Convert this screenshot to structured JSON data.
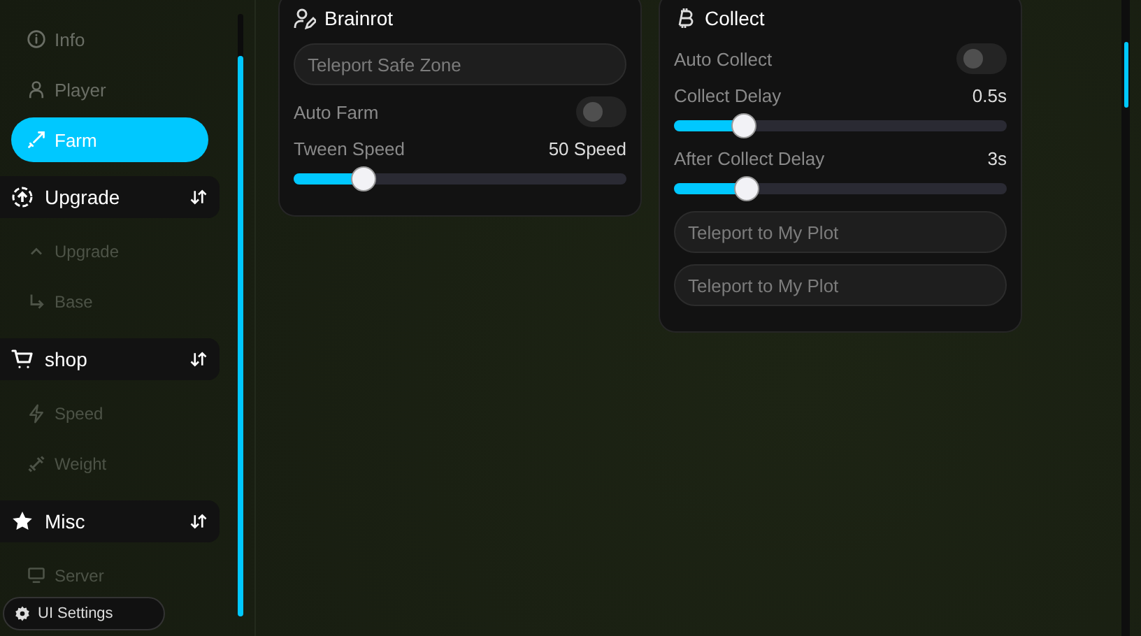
{
  "sidebar": {
    "tabs": [
      {
        "label": "Info",
        "selected": false
      },
      {
        "label": "Player",
        "selected": false
      },
      {
        "label": "Farm",
        "selected": true
      }
    ],
    "sections": [
      {
        "title": "Upgrade",
        "items": [
          {
            "label": "Upgrade",
            "selected": false
          },
          {
            "label": "Base",
            "selected": false
          }
        ]
      },
      {
        "title": "shop",
        "items": [
          {
            "label": "Speed",
            "selected": false
          },
          {
            "label": "Weight",
            "selected": false
          }
        ]
      },
      {
        "title": "Misc",
        "items": [
          {
            "label": "Server",
            "selected": false
          }
        ]
      }
    ]
  },
  "ui_settings": {
    "label": "UI Settings"
  },
  "cards": [
    {
      "title": "Brainrot",
      "controls": [
        {
          "kind": "button",
          "label": "Teleport Safe Zone"
        },
        {
          "kind": "toggle",
          "label": "Auto Farm",
          "on": false
        },
        {
          "kind": "slider",
          "label": "Tween Speed",
          "reading": "50 Speed",
          "level": 0.21
        }
      ]
    },
    {
      "title": "Collect",
      "controls": [
        {
          "kind": "toggle",
          "label": "Auto Collect",
          "on": false
        },
        {
          "kind": "slider",
          "label": "Collect Delay",
          "reading": "0.5s",
          "level": 0.21
        },
        {
          "kind": "slider",
          "label": "After Collect Delay",
          "reading": "3s",
          "level": 0.22
        },
        {
          "kind": "button",
          "label": "Teleport to My Plot"
        },
        {
          "kind": "button",
          "label": "Teleport to My Plot"
        }
      ]
    }
  ]
}
